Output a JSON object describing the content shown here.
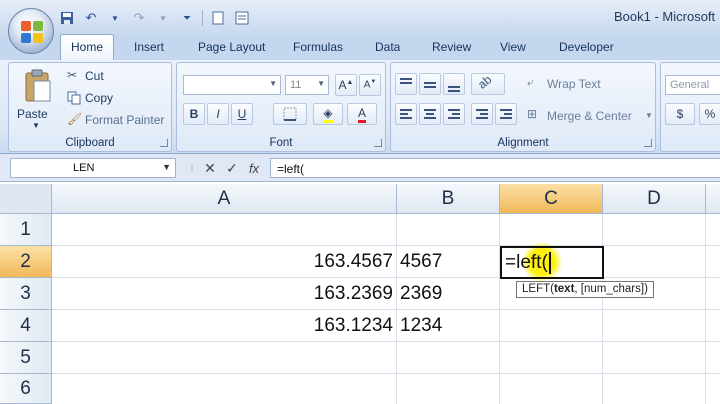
{
  "window": {
    "title": "Book1 - Microsoft"
  },
  "tabs": [
    "Home",
    "Insert",
    "Page Layout",
    "Formulas",
    "Data",
    "Review",
    "View",
    "Developer"
  ],
  "clipboard": {
    "paste": "Paste",
    "cut": "Cut",
    "copy": "Copy",
    "format_painter": "Format Painter",
    "label": "Clipboard"
  },
  "font": {
    "size": "11",
    "label": "Font"
  },
  "alignment": {
    "wrap_text": "Wrap Text",
    "merge_center": "Merge & Center",
    "label": "Alignment"
  },
  "number": {
    "format": "General",
    "currency": "$",
    "percent": "%"
  },
  "formula_bar": {
    "name_box": "LEN",
    "fx": "fx",
    "formula": "=left("
  },
  "grid": {
    "columns": [
      "A",
      "B",
      "C",
      "D"
    ],
    "rows": [
      "1",
      "2",
      "3",
      "4",
      "5",
      "6"
    ],
    "cells": {
      "A2": "163.4567",
      "B2": "4567",
      "A3": "163.2369",
      "B3": "2369",
      "A4": "163.1234",
      "B4": "1234",
      "C2": "=left("
    },
    "active_cell": "C2"
  },
  "tooltip": {
    "fn": "LEFT(",
    "arg1": "text",
    "rest": ", [num_chars])"
  },
  "colors": {
    "selected_header": "#f2b85a",
    "ribbon_bg": "#dce7f6"
  }
}
